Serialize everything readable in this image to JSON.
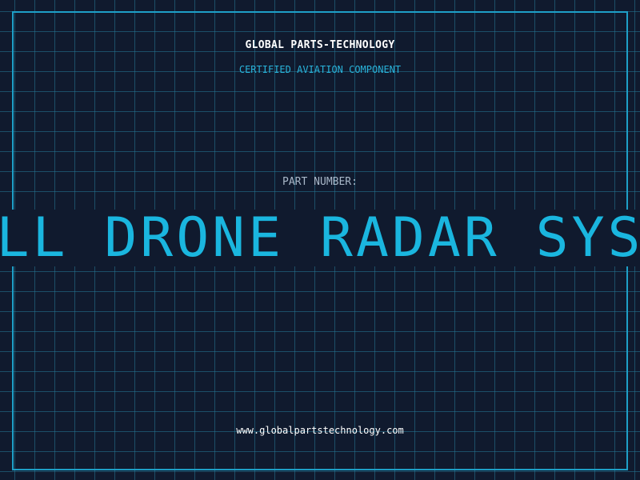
{
  "header": {
    "brand": "GLOBAL PARTS-TECHNOLOGY",
    "tagline": "CERTIFIED AVIATION COMPONENT"
  },
  "part": {
    "label": "PART NUMBER:",
    "value": "SMALL DRONE RADAR SYSTEM"
  },
  "footer": {
    "website": "www.globalpartstechnology.com"
  },
  "colors": {
    "background": "#101a2e",
    "grid": "#267896",
    "accent": "#1ab6df",
    "frame": "#1e9fc7"
  }
}
